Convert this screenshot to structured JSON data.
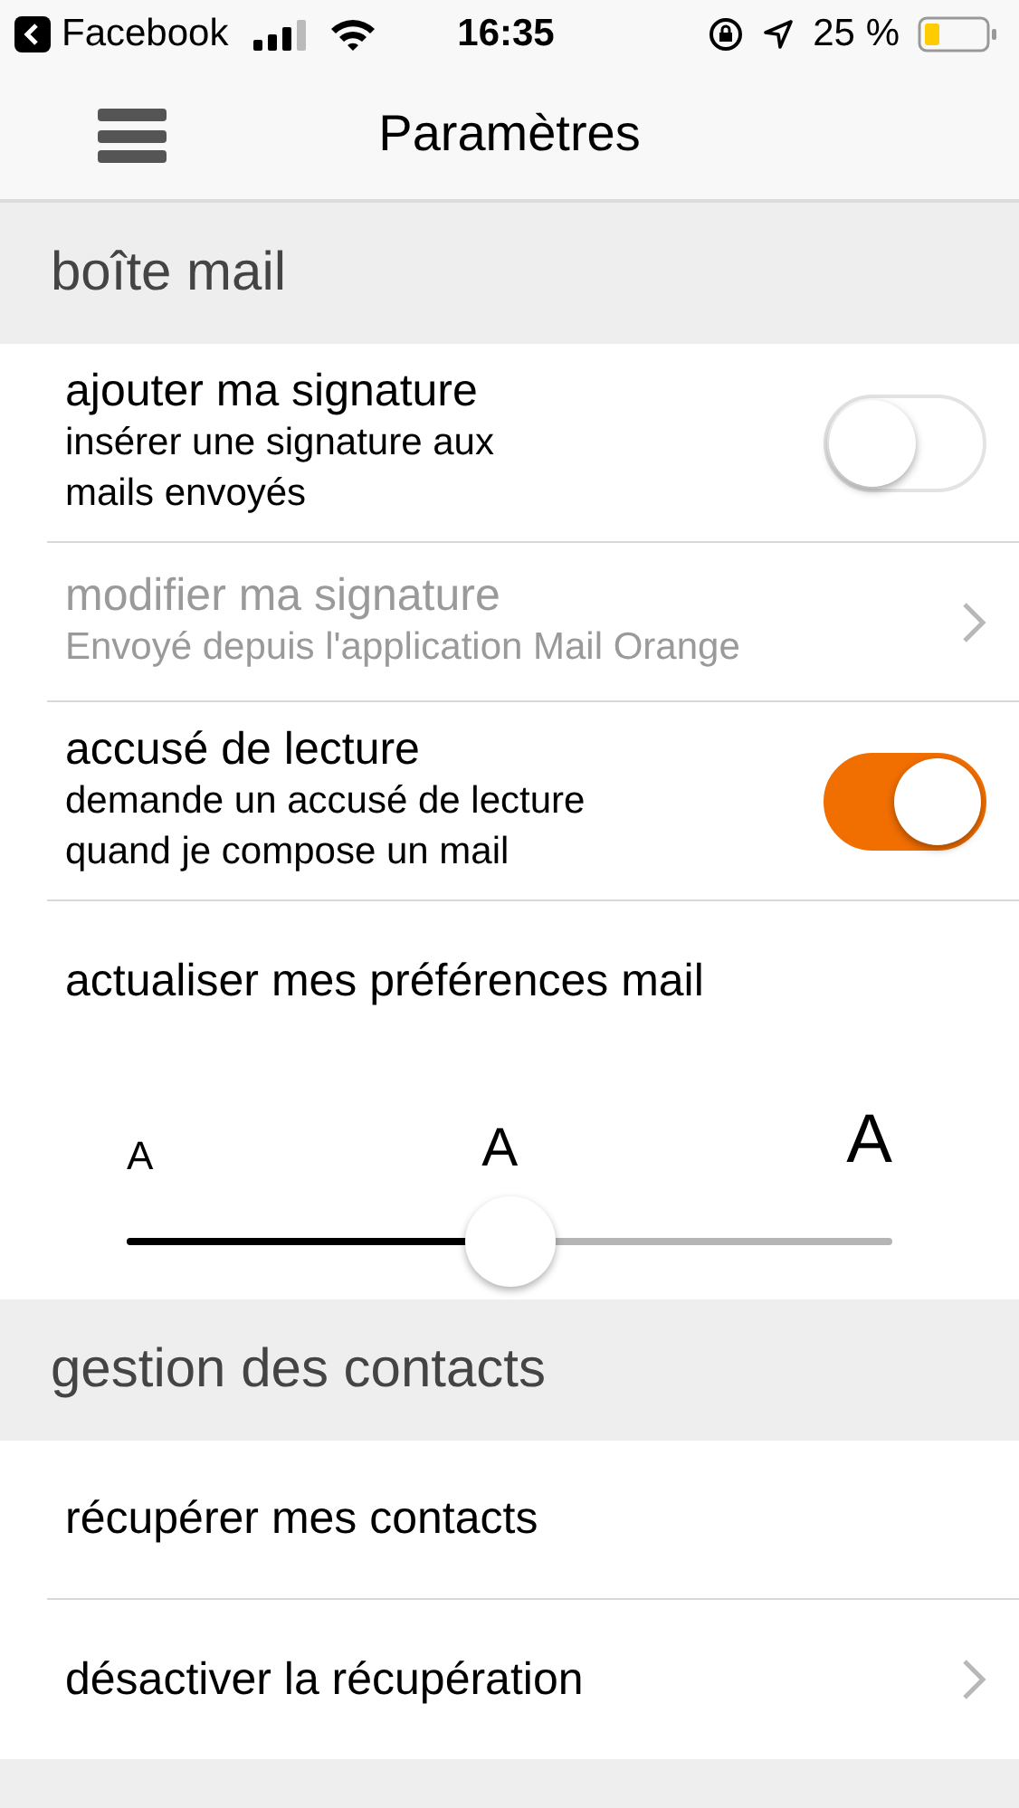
{
  "status_bar": {
    "back_app": "Facebook",
    "time": "16:35",
    "battery_text": "25 %"
  },
  "nav": {
    "title": "Paramètres"
  },
  "sections": [
    {
      "title": "boîte mail",
      "items": [
        {
          "kind": "toggle",
          "label": "ajouter ma signature",
          "detail": "insérer une signature aux mails envoyés",
          "on": false,
          "disabled": false
        },
        {
          "kind": "link",
          "label": "modifier ma signature",
          "detail": "Envoyé depuis l'application Mail Orange",
          "disabled": true
        },
        {
          "kind": "toggle",
          "label": "accusé de lecture",
          "detail": "demande un accusé de lecture quand je compose un mail",
          "on": true,
          "disabled": false
        },
        {
          "kind": "plain",
          "label": "actualiser mes préférences mail",
          "disabled": false
        },
        {
          "kind": "slider",
          "marks": [
            "A",
            "A",
            "A"
          ],
          "level": 0.5
        }
      ]
    },
    {
      "title": "gestion des contacts",
      "items": [
        {
          "kind": "plain",
          "label": "récupérer mes contacts",
          "disabled": false
        },
        {
          "kind": "link",
          "label": "désactiver la récupération",
          "disabled": false
        }
      ]
    }
  ]
}
